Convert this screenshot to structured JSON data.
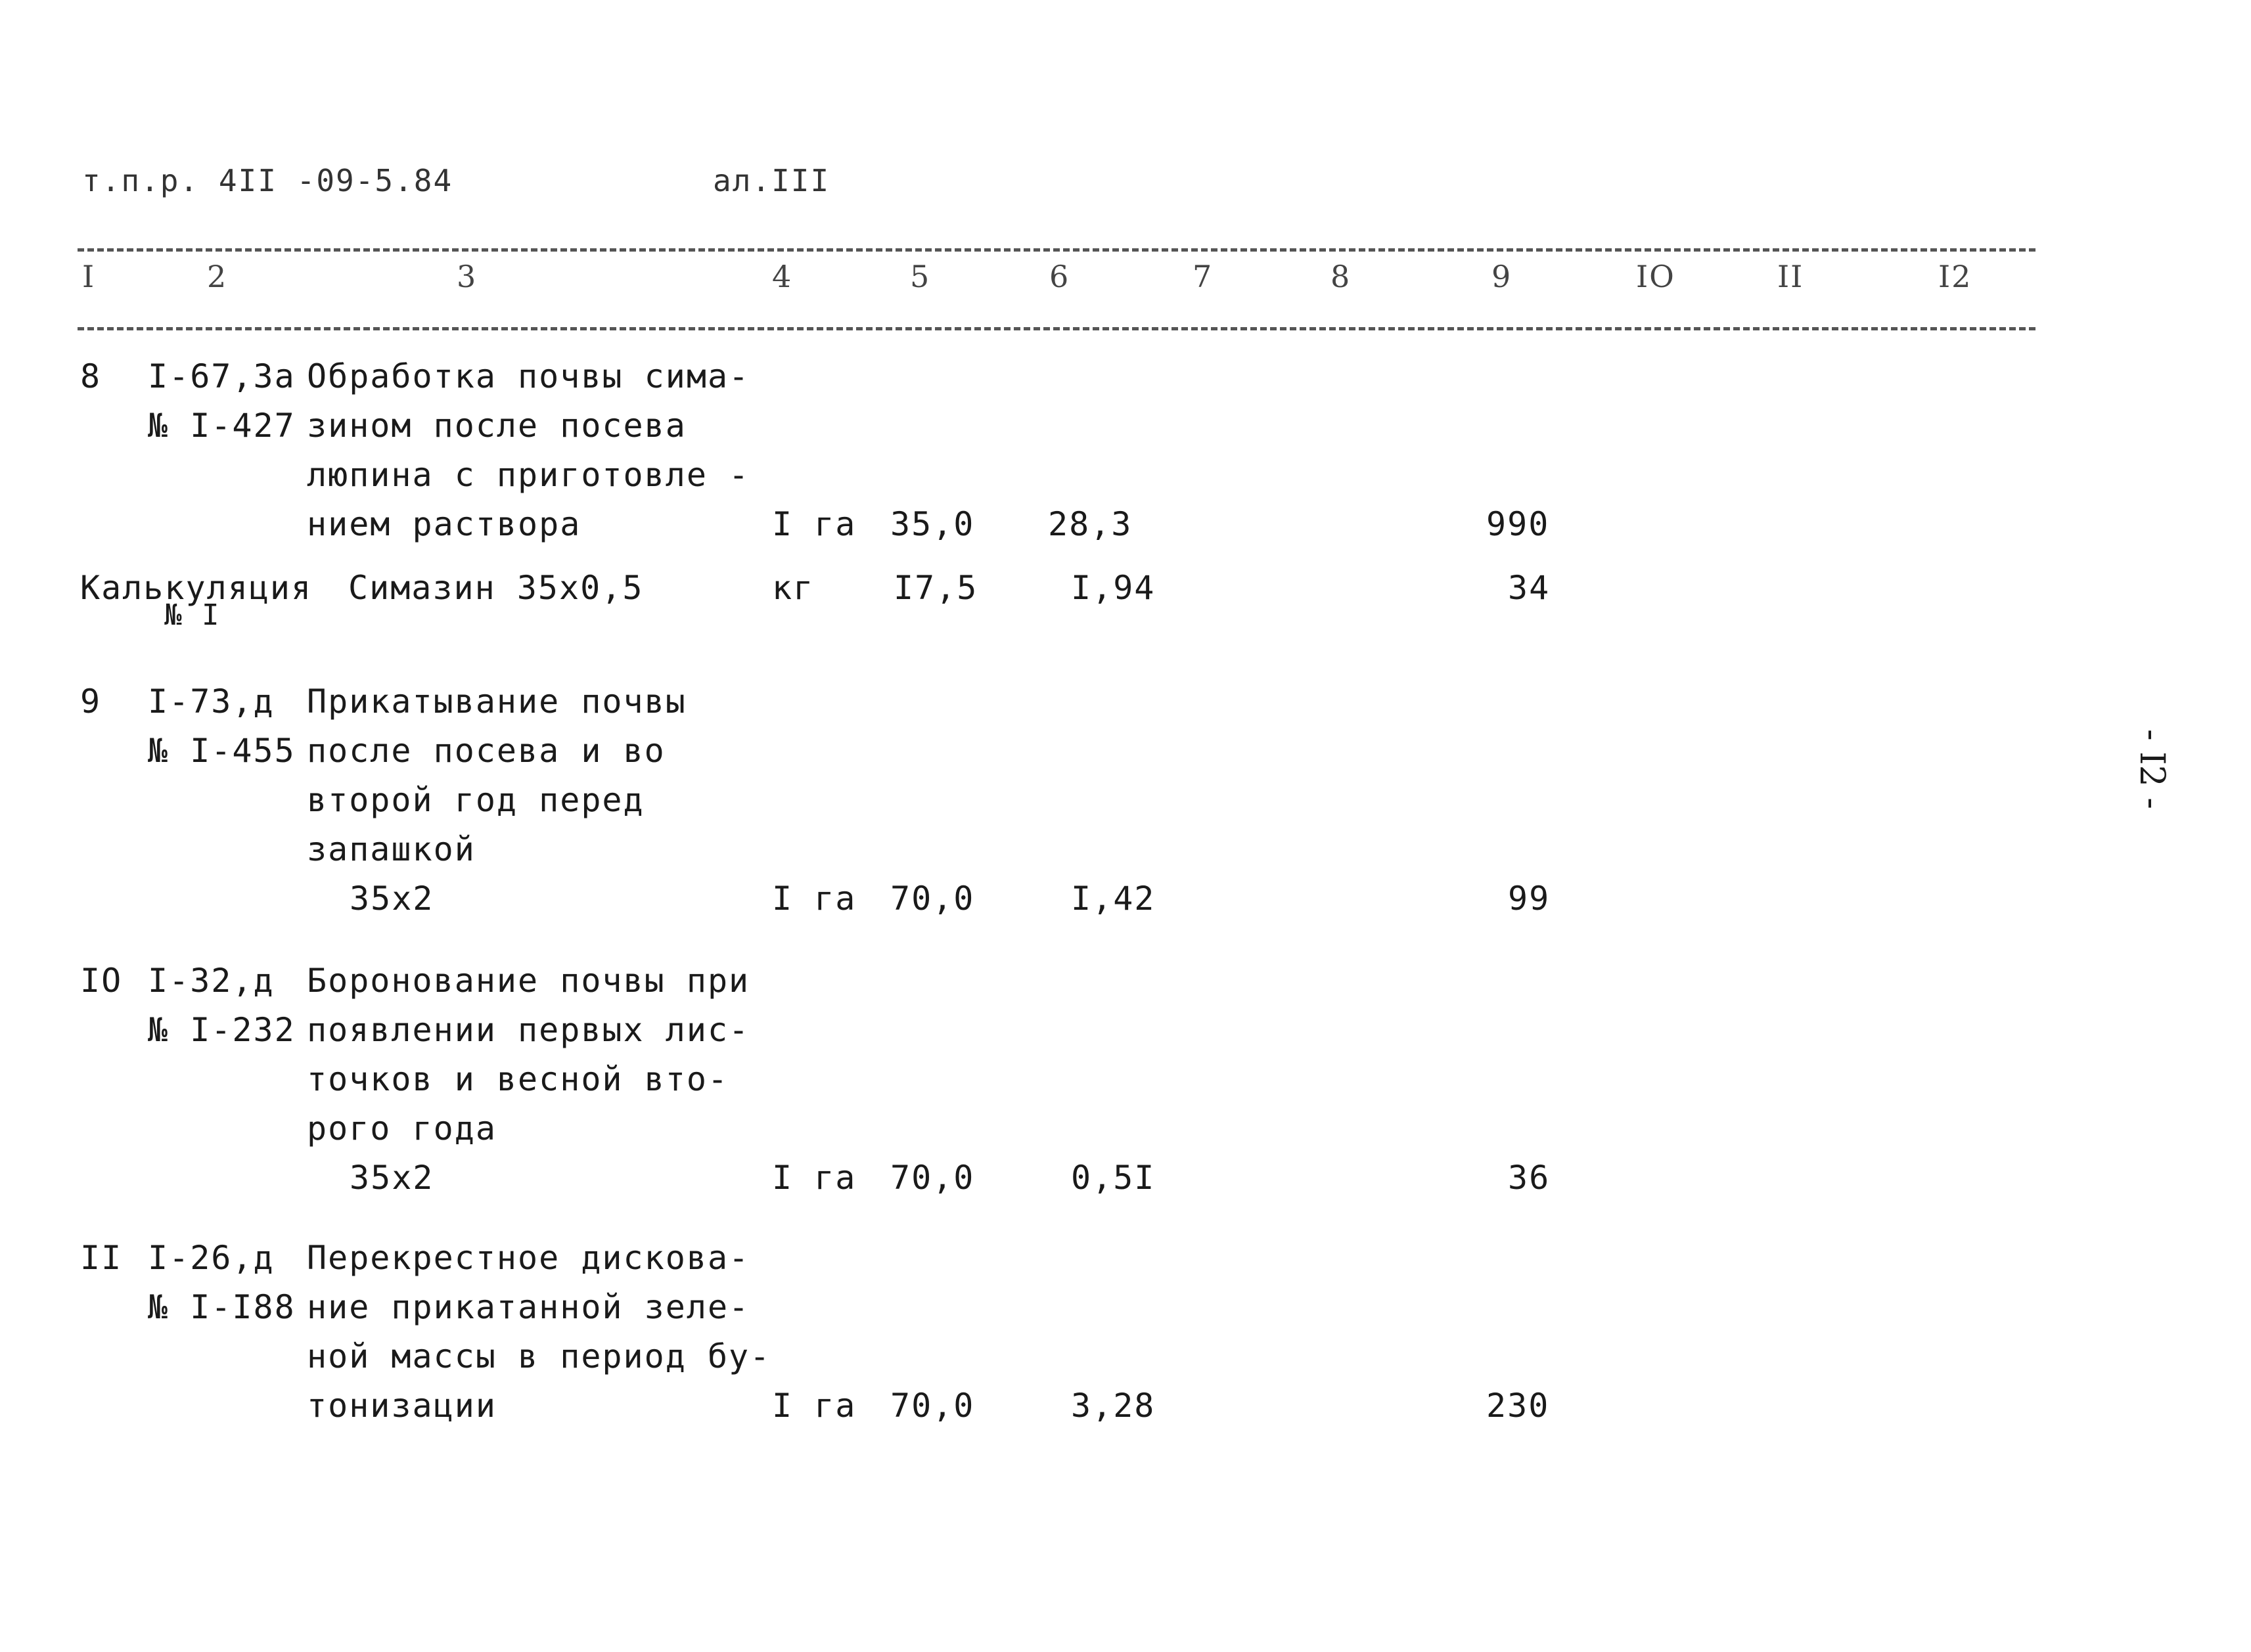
{
  "header": {
    "doc_ref": "т.п.р. 4II -09-5.84",
    "album": "ал.III"
  },
  "columns": [
    "I",
    "2",
    "3",
    "4",
    "5",
    "6",
    "7",
    "8",
    "9",
    "IO",
    "II",
    "I2"
  ],
  "rows": [
    {
      "num": "8",
      "code": "I-67,3а",
      "ref": "№ I-427",
      "desc": [
        "Обработка почвы сима-",
        "зином после посева",
        "люпина с приготовле -",
        "нием раствора"
      ],
      "unit": "I га",
      "qty": "35,0",
      "rate": "28,3",
      "total": "990"
    },
    {
      "num": "Калькуляция",
      "ref": "№ I",
      "desc": [
        "Симазин 35х0,5"
      ],
      "unit": "кг",
      "qty": "I7,5",
      "rate": "I,94",
      "total": "34"
    },
    {
      "num": "9",
      "code": "I-73,д",
      "ref": "№ I-455",
      "desc": [
        "Прикатывание почвы",
        "после посева и во",
        "второй год перед",
        "запашкой"
      ],
      "formula": "35х2",
      "unit": "I га",
      "qty": "70,0",
      "rate": "I,42",
      "total": "99"
    },
    {
      "num": "IO",
      "code": "I-32,д",
      "ref": "№ I-232",
      "desc": [
        "Боронование почвы при",
        "появлении первых лис-",
        "точков и весной вто-",
        "рого года"
      ],
      "formula": "35х2",
      "unit": "I га",
      "qty": "70,0",
      "rate": "0,5I",
      "total": "36"
    },
    {
      "num": "II",
      "code": "I-26,д",
      "ref": "№ I-I88",
      "desc": [
        "Перекрестное дискова-",
        "ние прикатанной зеле-",
        "ной массы в период бу-",
        "тонизации"
      ],
      "unit": "I га",
      "qty": "70,0",
      "rate": "3,28",
      "total": "230"
    }
  ],
  "page_number": "- I2 -"
}
